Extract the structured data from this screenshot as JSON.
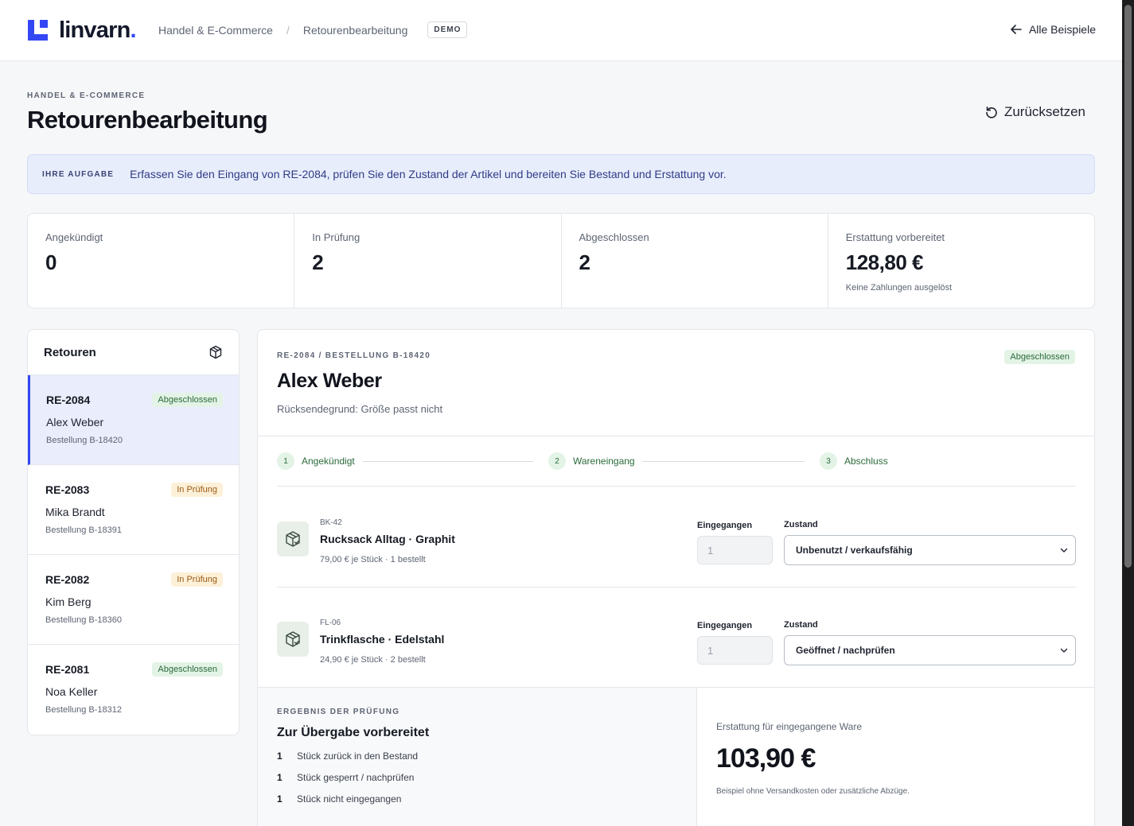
{
  "header": {
    "logo_text": "linvarn",
    "logo_dot": ".",
    "breadcrumb": [
      "Handel & E-Commerce",
      "Retourenbearbeitung"
    ],
    "breadcrumb_separator": "/",
    "demo_badge": "DEMO",
    "all_examples": "Alle Beispiele"
  },
  "page": {
    "eyebrow": "HANDEL & E-COMMERCE",
    "title": "Retourenbearbeitung",
    "reset_label": "Zurücksetzen"
  },
  "task": {
    "label": "IHRE AUFGABE",
    "text": "Erfassen Sie den Eingang von RE-2084, prüfen Sie den Zustand der Artikel und bereiten Sie Bestand und Erstattung vor."
  },
  "stats": [
    {
      "label": "Angekündigt",
      "value": "0",
      "note": ""
    },
    {
      "label": "In Prüfung",
      "value": "2",
      "note": ""
    },
    {
      "label": "Abgeschlossen",
      "value": "2",
      "note": ""
    },
    {
      "label": "Erstattung vorbereitet",
      "value": "128,80 €",
      "note": "Keine Zahlungen ausgelöst"
    }
  ],
  "returns": {
    "title": "Retouren",
    "items": [
      {
        "id": "RE-2084",
        "status": "Abgeschlossen",
        "name": "Alex Weber",
        "order": "Bestellung B-18420"
      },
      {
        "id": "RE-2083",
        "status": "In Prüfung",
        "name": "Mika Brandt",
        "order": "Bestellung B-18391"
      },
      {
        "id": "RE-2082",
        "status": "In Prüfung",
        "name": "Kim Berg",
        "order": "Bestellung B-18360"
      },
      {
        "id": "RE-2081",
        "status": "Abgeschlossen",
        "name": "Noa Keller",
        "order": "Bestellung B-18312"
      }
    ]
  },
  "detail": {
    "eyebrow": "RE-2084 / BESTELLUNG B-18420",
    "status": "Abgeschlossen",
    "name": "Alex Weber",
    "reason": "Rücksendegrund: Größe passt nicht",
    "steps": [
      {
        "num": "1",
        "label": "Angekündigt"
      },
      {
        "num": "2",
        "label": "Wareneingang"
      },
      {
        "num": "3",
        "label": "Abschluss"
      }
    ],
    "field_received": "Eingegangen",
    "field_condition": "Zustand",
    "items": [
      {
        "sku": "BK-42",
        "name": "Rucksack Alltag · Graphit",
        "price": "79,00 € je Stück · 1 bestellt",
        "received": "1",
        "condition": "Unbenutzt / verkaufsfähig"
      },
      {
        "sku": "FL-06",
        "name": "Trinkflasche · Edelstahl",
        "price": "24,90 € je Stück · 2 bestellt",
        "received": "1",
        "condition": "Geöffnet / nachprüfen"
      }
    ]
  },
  "result": {
    "eyebrow": "ERGEBNIS DER PRÜFUNG",
    "title": "Zur Übergabe vorbereitet",
    "rows": [
      {
        "n": "1",
        "text": "Stück zurück in den Bestand"
      },
      {
        "n": "1",
        "text": "Stück gesperrt / nachprüfen"
      },
      {
        "n": "1",
        "text": "Stück nicht eingegangen"
      }
    ],
    "refund_label": "Erstattung für eingegangene Ware",
    "refund_value": "103,90 €",
    "refund_note": "Beispiel ohne Versandkosten oder zusätzliche Abzüge."
  },
  "colors": {
    "accent": "#3347f5",
    "success_bg": "#e3f3e6",
    "success_text": "#2b6b3b",
    "warning_bg": "#fdf0d8",
    "warning_text": "#9a5a12"
  }
}
